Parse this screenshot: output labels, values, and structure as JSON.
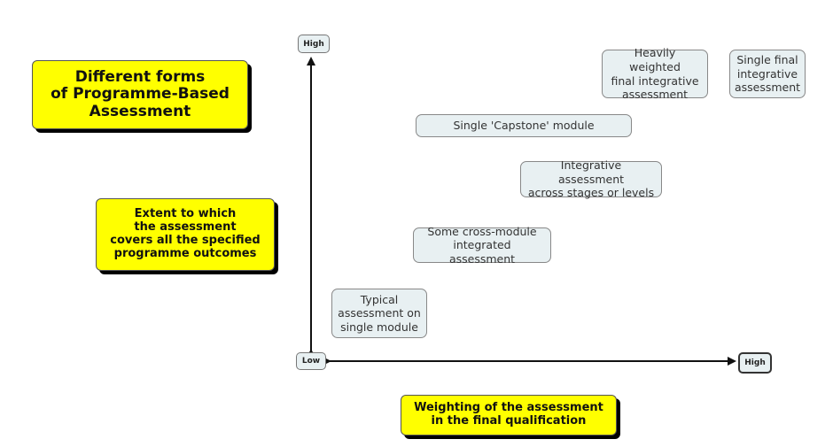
{
  "title": "Different forms\nof Programme-Based\nAssessment",
  "y_axis": {
    "label": "Extent to which\nthe assessment\ncovers all the specified\nprogramme outcomes",
    "high": "High",
    "low": "Low"
  },
  "x_axis": {
    "label": "Weighting of the assessment\nin the final qualification",
    "low": "Low",
    "high": "High"
  },
  "nodes": [
    {
      "id": "typical",
      "text": "Typical\nassessment on\nsingle module"
    },
    {
      "id": "cross-module",
      "text": "Some cross-module\nintegrated assessment"
    },
    {
      "id": "integrative-stages",
      "text": "Integrative assessment\nacross stages or levels"
    },
    {
      "id": "capstone",
      "text": "Single 'Capstone' module"
    },
    {
      "id": "heavily-weighted",
      "text": "Heavily weighted\nfinal integrative\nassessment"
    },
    {
      "id": "single-final",
      "text": "Single final\nintegrative\nassessment"
    }
  ],
  "colors": {
    "highlight": "#ffff00",
    "node_fill": "#e8f0f2",
    "node_border": "#888888"
  }
}
